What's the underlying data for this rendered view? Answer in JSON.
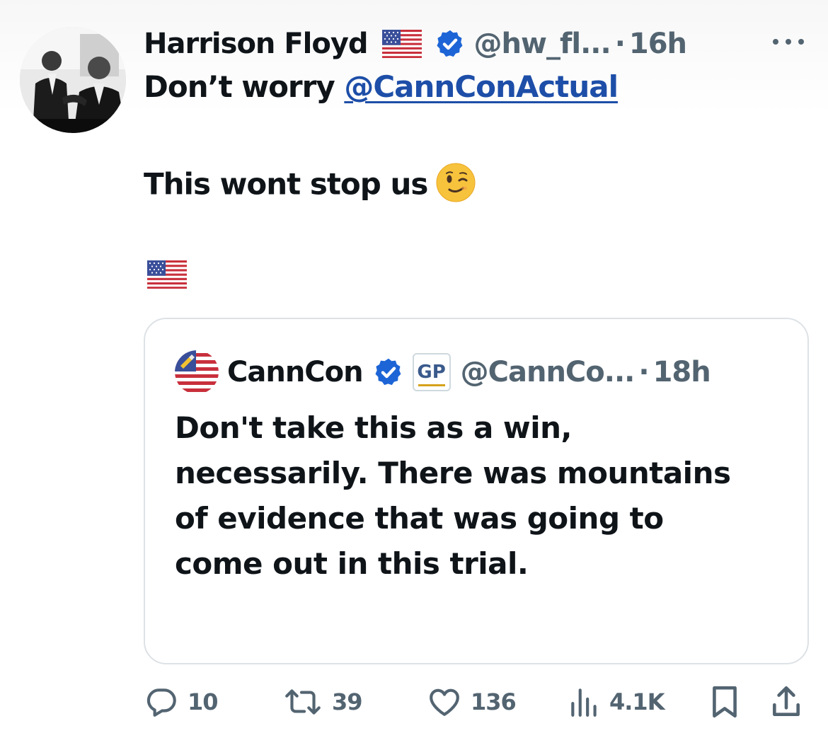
{
  "tweet": {
    "display_name": "Harrison Floyd",
    "handle": "@hw_fl...",
    "separator": "·",
    "time": "16h",
    "body_prefix": "Don’t worry ",
    "mention": "@CannConActual",
    "body_line2": "This wont stop us",
    "icons": {
      "avatar": "avatar-photo",
      "flag": "us-flag-icon",
      "verified": "verified-badge-icon",
      "more": "more-icon",
      "wink": "winking-face-emoji"
    }
  },
  "quote": {
    "display_name": "CannCon",
    "affiliation_badge": "GP",
    "handle": "@CannCo...",
    "separator": "·",
    "time": "18h",
    "lines": [
      "Don't take this as a win,",
      "necessarily.  There was mountains",
      "of evidence that was going to",
      "come out in this trial."
    ]
  },
  "actions": {
    "replies": "10",
    "reposts": "39",
    "likes": "136",
    "views": "4.1K"
  },
  "colors": {
    "text": "#0f1419",
    "secondary": "#536471",
    "link": "#1d4ea8",
    "verified_blue": "#1d65d6",
    "border": "#dde2e6"
  }
}
